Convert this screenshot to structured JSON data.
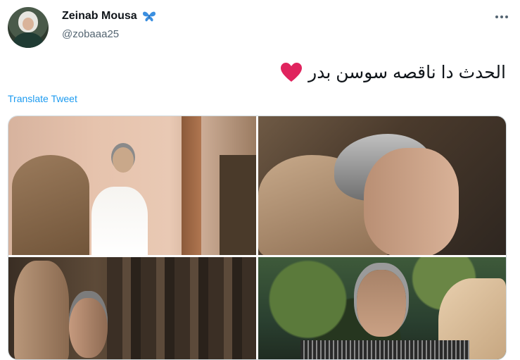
{
  "tweet": {
    "author": {
      "display_name": "Zeinab Mousa",
      "handle": "@zobaaa25"
    },
    "text": "الحدث دا ناقصه سوسن بدر",
    "translate_label": "Translate Tweet",
    "icons": {
      "verified": "butterfly-icon",
      "more": "more-options-icon",
      "emoji": "heart-icon"
    },
    "media_count": 4
  },
  "colors": {
    "link": "#1d9bf0",
    "handle": "#536471",
    "heart": "#e0245e",
    "butterfly": "#3b8fe0"
  }
}
